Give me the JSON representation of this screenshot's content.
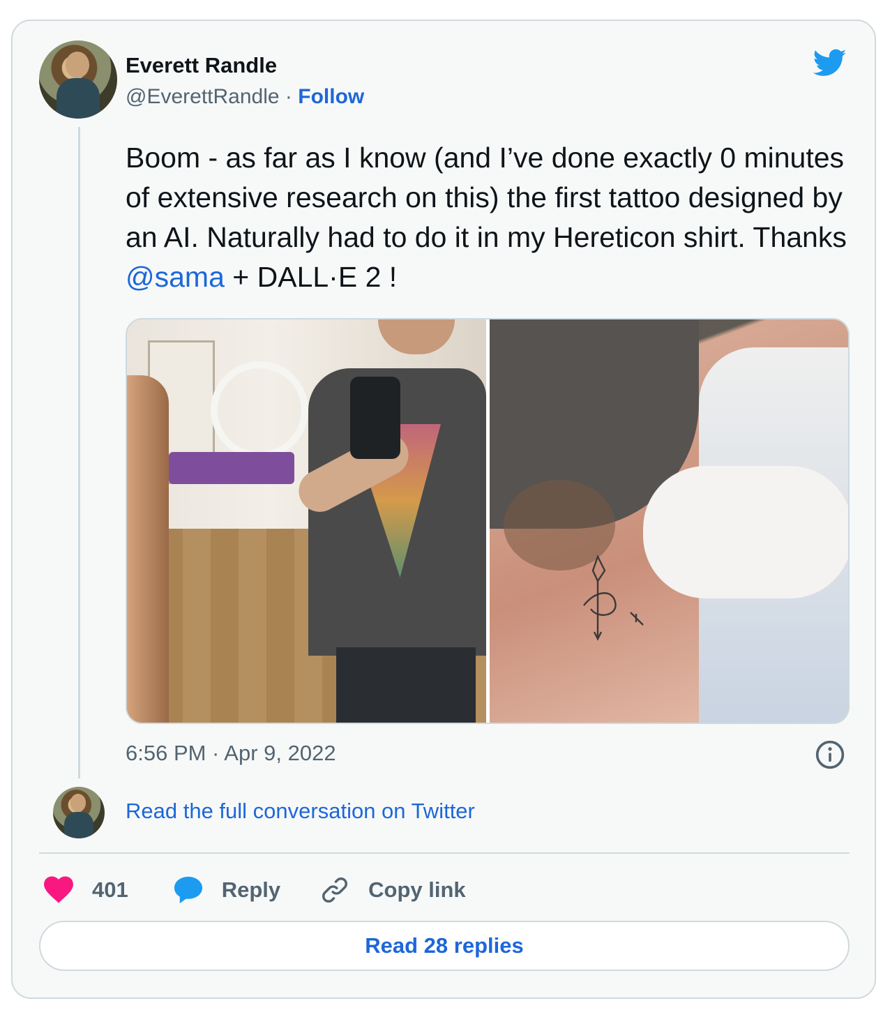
{
  "author": {
    "name": "Everett Randle",
    "handle": "@EverettRandle",
    "separator": "·",
    "follow_label": "Follow"
  },
  "tweet": {
    "text_before": "Boom - as far as I know (and I’ve done exactly 0 minutes of extensive research on this) the first tattoo designed by an AI. Naturally had to do it in my Hereticon shirt. Thanks ",
    "mention": "@sama",
    "text_after": " + DALL·E 2 !",
    "timestamp": "6:56 PM · Apr 9, 2022"
  },
  "conversation_link": "Read the full conversation on Twitter",
  "actions": {
    "like_count": "401",
    "reply_label": "Reply",
    "copy_link_label": "Copy link"
  },
  "read_replies_label": "Read 28 replies",
  "icons": {
    "brand": "twitter-bird-icon",
    "info": "info-icon",
    "like": "heart-icon",
    "reply": "reply-bubble-icon",
    "copy": "link-icon"
  },
  "colors": {
    "link": "#1d67d8",
    "twitter_blue": "#1d9bf0",
    "heart": "#f91880",
    "muted": "#536471",
    "border": "#cfd9de"
  }
}
